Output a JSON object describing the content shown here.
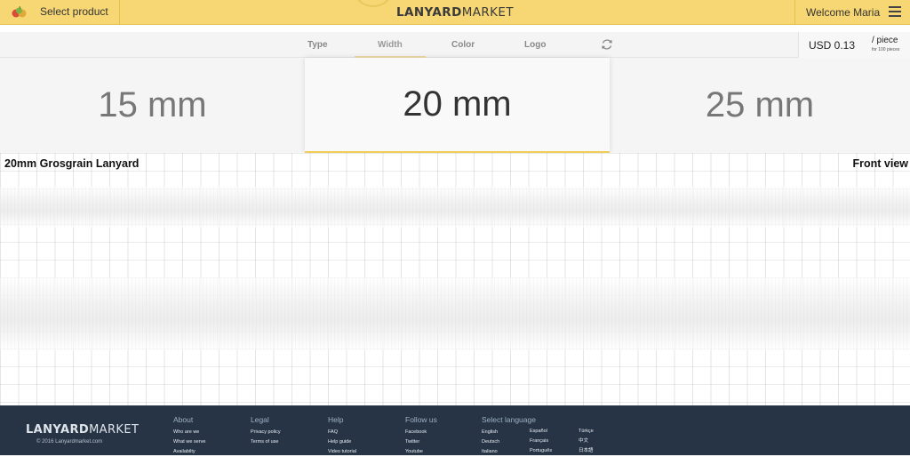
{
  "header": {
    "select_product": "Select product",
    "brand_bold": "LANYARD",
    "brand_light": "MARKET",
    "welcome": "Welcome Maria"
  },
  "tabs": [
    {
      "label": "Type"
    },
    {
      "label": "Width"
    },
    {
      "label": "Color"
    },
    {
      "label": "Logo"
    }
  ],
  "active_tab": "Width",
  "pricing": {
    "price": "USD 0.13",
    "unit": "/ piece",
    "note": "for 100 pieces"
  },
  "width_options": [
    {
      "label": "15 mm"
    },
    {
      "label": "20 mm"
    },
    {
      "label": "25 mm"
    }
  ],
  "selected_width": "20 mm",
  "preview": {
    "title": "20mm Grosgrain Lanyard",
    "view": "Front view"
  },
  "footer": {
    "brand_bold": "LANYARD",
    "brand_light": "MARKET",
    "copyright": "© 2016 Lanyardmarket.com",
    "columns": [
      {
        "heading": "About",
        "links": [
          "Who are we",
          "What we serve",
          "Availabilty"
        ]
      },
      {
        "heading": "Legal",
        "links": [
          "Privacy policy",
          "Terms of use"
        ]
      },
      {
        "heading": "Help",
        "links": [
          "FAQ",
          "Help guide",
          "Video tutorial"
        ]
      },
      {
        "heading": "Follow us",
        "links": [
          "Facebook",
          "Twitter",
          "Youtube"
        ]
      },
      {
        "heading": "Select language",
        "links": [
          "English",
          "Deutsch",
          "Italiano"
        ]
      },
      {
        "heading": "",
        "links": [
          "Español",
          "Français",
          "Português"
        ]
      },
      {
        "heading": "",
        "links": [
          "Türkçe",
          "中文",
          "日本語"
        ]
      }
    ]
  },
  "colors": {
    "header_bg": "#f7d774",
    "accent": "#f0cb55",
    "footer_bg": "#263446"
  },
  "icons": [
    "fruit-logo-icon",
    "menu-icon",
    "refresh-icon"
  ]
}
